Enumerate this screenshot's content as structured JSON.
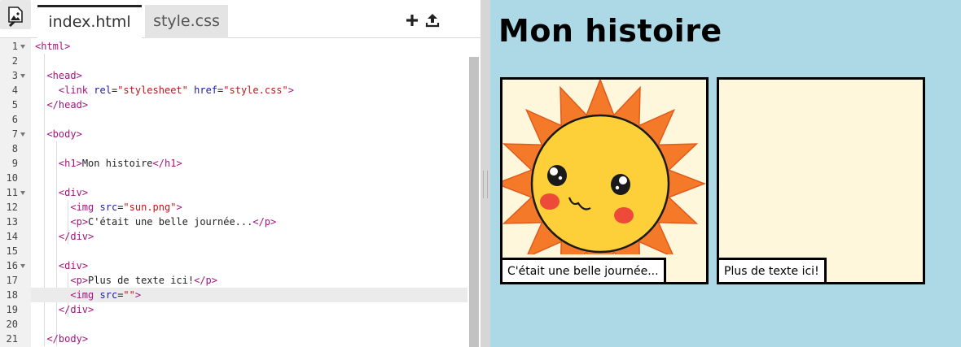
{
  "editor": {
    "tabs": [
      {
        "label": "index.html",
        "active": true
      },
      {
        "label": "style.css",
        "active": false
      }
    ],
    "toolbar_icons": [
      "add-icon",
      "upload-icon",
      "image-icon"
    ],
    "line_numbers": [
      "1",
      "2",
      "3",
      "4",
      "5",
      "6",
      "7",
      "8",
      "9",
      "10",
      "11",
      "12",
      "13",
      "14",
      "15",
      "16",
      "17",
      "18",
      "19",
      "20",
      "21"
    ],
    "code_lines": [
      "<html>",
      "",
      "  <head>",
      "    <link rel=\"stylesheet\" href=\"style.css\">",
      "  </head>",
      "",
      "  <body>",
      "",
      "    <h1>Mon histoire</h1>",
      "",
      "    <div>",
      "      <img src=\"sun.png\">",
      "      <p>C'était une belle journée...</p>",
      "    </div>",
      "",
      "    <div>",
      "      <p>Plus de texte ici!</p>",
      "      <img src=\"\">",
      "    </div>",
      "",
      "  </body>"
    ],
    "active_line": 18,
    "fold_lines": [
      1,
      3,
      7,
      11,
      16
    ]
  },
  "preview": {
    "title": "Mon histoire",
    "panels": [
      {
        "image": "sun-image",
        "caption": "C'était une belle journée..."
      },
      {
        "image": "",
        "caption": "Plus de texte ici!"
      }
    ],
    "background_color": "#add8e6",
    "panel_color": "#fff7dc"
  }
}
